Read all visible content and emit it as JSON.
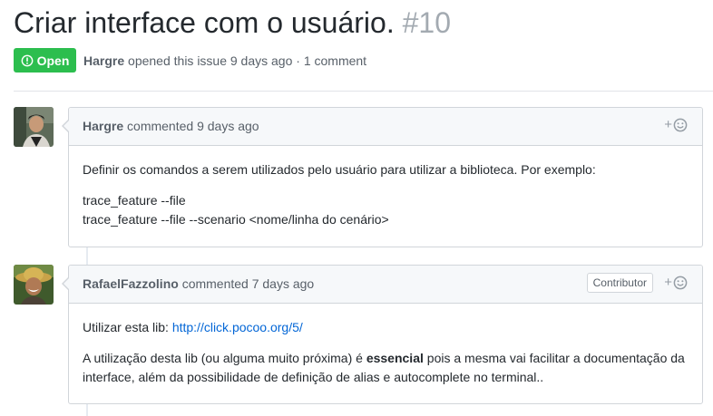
{
  "issue": {
    "title": "Criar interface com o usuário.",
    "number": "#10",
    "state": "Open",
    "author": "Hargre",
    "meta_rest": "opened this issue 9 days ago · 1 comment"
  },
  "comments": [
    {
      "author": "Hargre",
      "header_rest": "commented 9 days ago",
      "body": {
        "intro": "Definir os comandos a serem utilizados pelo usuário para utilizar a biblioteca. Por exemplo:",
        "line1": "trace_feature --file",
        "line2": "trace_feature --file --scenario <nome/linha do cenário>"
      }
    },
    {
      "author": "RafaelFazzolino",
      "header_rest": "commented 7 days ago",
      "role": "Contributor",
      "body": {
        "lib_prefix": "Utilizar esta lib: ",
        "lib_link": "http://click.pocoo.org/5/",
        "p2_a": "A utilização desta lib (ou alguma muito próxima) é ",
        "p2_strong": "essencial",
        "p2_b": " pois a mesma vai facilitar a documentação da interface, além da possibilidade de definição de alias e autocomplete no terminal.."
      }
    }
  ],
  "reaction_plus": "+",
  "icons": {
    "state": "issue-opened-icon",
    "reaction": "smiley-icon"
  },
  "colors": {
    "open_badge": "#2cbe4e",
    "link": "#0366d6",
    "issue_number": "#a3aab1",
    "header_bg": "#f6f8fa",
    "border": "#d1d5da"
  }
}
